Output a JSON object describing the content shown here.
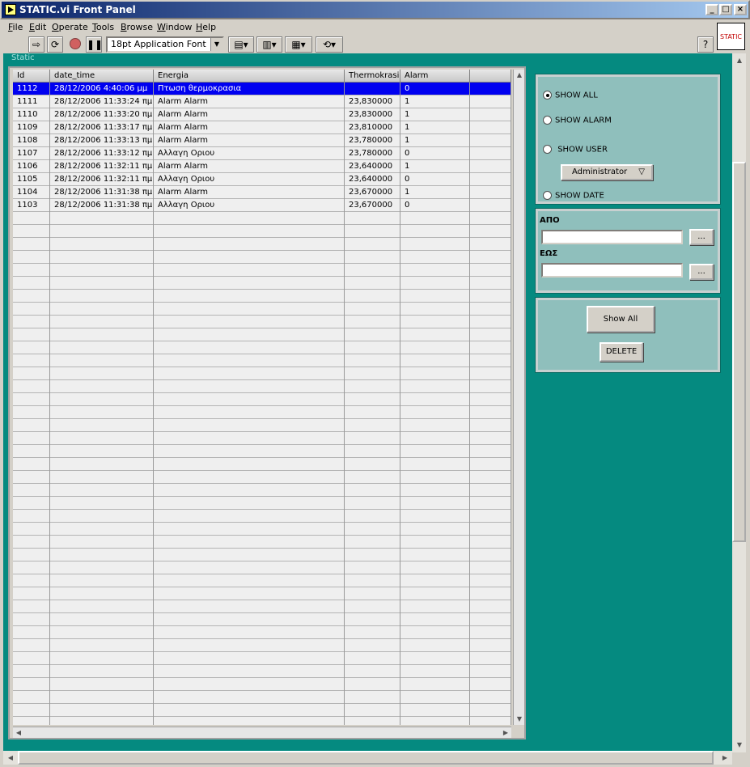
{
  "window": {
    "title": "STATIC.vi Front Panel"
  },
  "menu": [
    "File",
    "Edit",
    "Operate",
    "Tools",
    "Browse",
    "Window",
    "Help"
  ],
  "toolbar": {
    "font": "18pt Application Font",
    "vi_icon_text": "STATIC",
    "help_glyph": "?"
  },
  "panel": {
    "label": "Static"
  },
  "table": {
    "columns": [
      "Id",
      "date_time",
      "Energia",
      "Thermokrasia",
      "Alarm"
    ],
    "rows": [
      [
        "1112",
        "28/12/2006 4:40:06 μμ",
        "Πτωση  θερμοκρασια",
        "",
        "0"
      ],
      [
        "1111",
        "28/12/2006 11:33:24 πμ",
        "Alarm Alarm",
        "23,830000",
        "1"
      ],
      [
        "1110",
        "28/12/2006 11:33:20 πμ",
        "Alarm Alarm",
        "23,830000",
        "1"
      ],
      [
        "1109",
        "28/12/2006 11:33:17 πμ",
        "Alarm Alarm",
        "23,810000",
        "1"
      ],
      [
        "1108",
        "28/12/2006 11:33:13 πμ",
        "Alarm Alarm",
        "23,780000",
        "1"
      ],
      [
        "1107",
        "28/12/2006 11:33:12 πμ",
        "Αλλαγη Οριου",
        "23,780000",
        "0"
      ],
      [
        "1106",
        "28/12/2006 11:32:11 πμ",
        "Alarm Alarm",
        "23,640000",
        "1"
      ],
      [
        "1105",
        "28/12/2006 11:32:11 πμ",
        "Αλλαγη Οριου",
        "23,640000",
        "0"
      ],
      [
        "1104",
        "28/12/2006 11:31:38 πμ",
        "Alarm Alarm",
        "23,670000",
        "1"
      ],
      [
        "1103",
        "28/12/2006 11:31:38 πμ",
        "Αλλαγη Οριου",
        "23,670000",
        "0"
      ]
    ],
    "selected_row": 0
  },
  "filters": {
    "show_all": "SHOW ALL",
    "show_alarm": "SHOW ALARM",
    "show_user": "SHOW USER",
    "user_value": "Administrator",
    "show_date": "SHOW DATE",
    "selected": "show_all"
  },
  "date_range": {
    "from_label": "ΑΠΟ",
    "to_label": "ΕΩΣ",
    "from_value": "",
    "to_value": "",
    "browse_label": "..."
  },
  "actions": {
    "show_all": "Show All",
    "delete": "DELETE"
  },
  "colors": {
    "panel_bg": "#058a80",
    "box_bg": "#8fbfbc",
    "selected_row": "#0000f0"
  }
}
